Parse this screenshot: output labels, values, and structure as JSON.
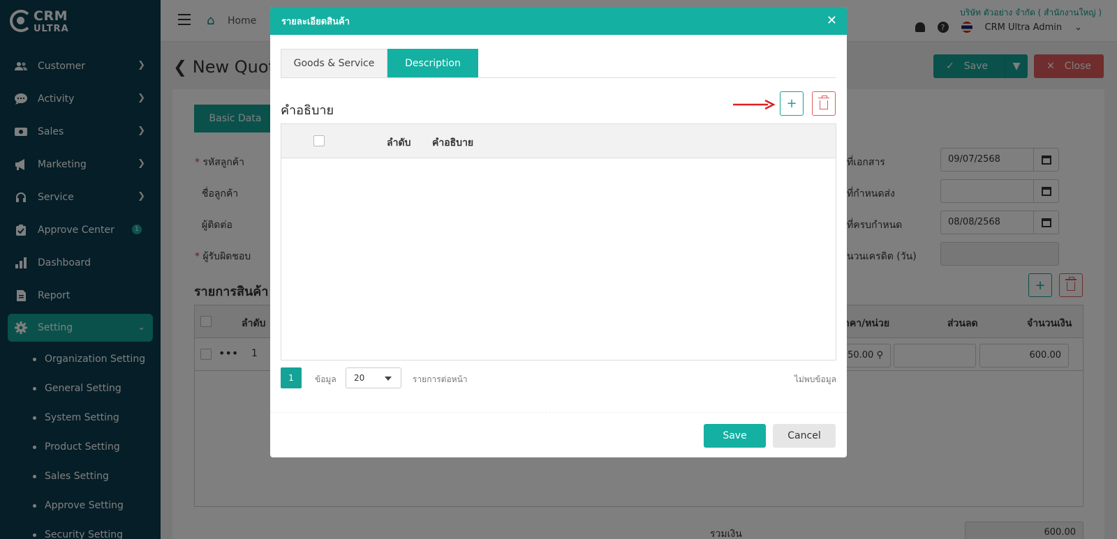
{
  "app": {
    "logo_line1": "CRM",
    "logo_line2": "ULTRA"
  },
  "sidebar": {
    "items": [
      {
        "label": "Customer",
        "icon": "users-icon"
      },
      {
        "label": "Activity",
        "icon": "chat-icon"
      },
      {
        "label": "Sales",
        "icon": "money-icon"
      },
      {
        "label": "Marketing",
        "icon": "megaphone-icon"
      },
      {
        "label": "Service",
        "icon": "headset-icon"
      },
      {
        "label": "Approve Center",
        "icon": "clipboard-check-icon",
        "badge": "1"
      },
      {
        "label": "Dashboard",
        "icon": "bar-chart-icon"
      },
      {
        "label": "Report",
        "icon": "document-icon"
      },
      {
        "label": "Setting",
        "icon": "gear-icon"
      }
    ],
    "submenu": [
      "Organization Setting",
      "General Setting",
      "System Setting",
      "Product Setting",
      "Sales Setting",
      "Approve Setting",
      "Security Setting"
    ]
  },
  "topbar": {
    "home_label": "Home",
    "company": "บริษัท ตัวอย่าง จำกัด ( สำนักงานใหญ่ )",
    "user": "CRM Ultra Admin"
  },
  "page": {
    "title": "New Quot",
    "save_label": "Save",
    "close_label": "Close",
    "tab_basic": "Basic Data",
    "fields_left": [
      "รหัสลูกค้า",
      "ชื่อลูกค้า",
      "ผู้ติดต่อ",
      "ผู้รับผิดชอบ"
    ],
    "fields_right": [
      "ที่เอกสาร",
      "ที่กำหนดส่ง",
      "ที่ครบกำหนด",
      "นวนเครดิต (วัน)"
    ],
    "doc_date": "09/07/2568",
    "due_date": "08/08/2568",
    "section_title": "รายการสินค้า",
    "table_headers": {
      "seq": "ลำดับ",
      "price": "าคา/หน่วย",
      "discount": "ส่วนลด",
      "amount": "จำนวนเงิน"
    },
    "row": {
      "seq": "1",
      "price": "50.00",
      "amount": "600.00"
    },
    "total_label": "รวมเงิน",
    "total_value": "600.00"
  },
  "modal": {
    "title": "รายละเอียดสินค้า",
    "tabs": [
      "Goods & Service",
      "Description"
    ],
    "section_title": "คำอธิบาย",
    "headers": {
      "seq": "ลำดับ",
      "desc": "คำอธิบาย"
    },
    "pager": {
      "page": "1",
      "data_label": "ข้อมูล",
      "page_size": "20",
      "per_page_label": "รายการต่อหน้า",
      "empty_label": "ไม่พบข้อมูล"
    },
    "save_label": "Save",
    "cancel_label": "Cancel"
  },
  "colors": {
    "primary": "#14b0a2",
    "sidebar": "#0b3d4f",
    "danger": "#e05a5a",
    "arrow": "#e02020"
  }
}
